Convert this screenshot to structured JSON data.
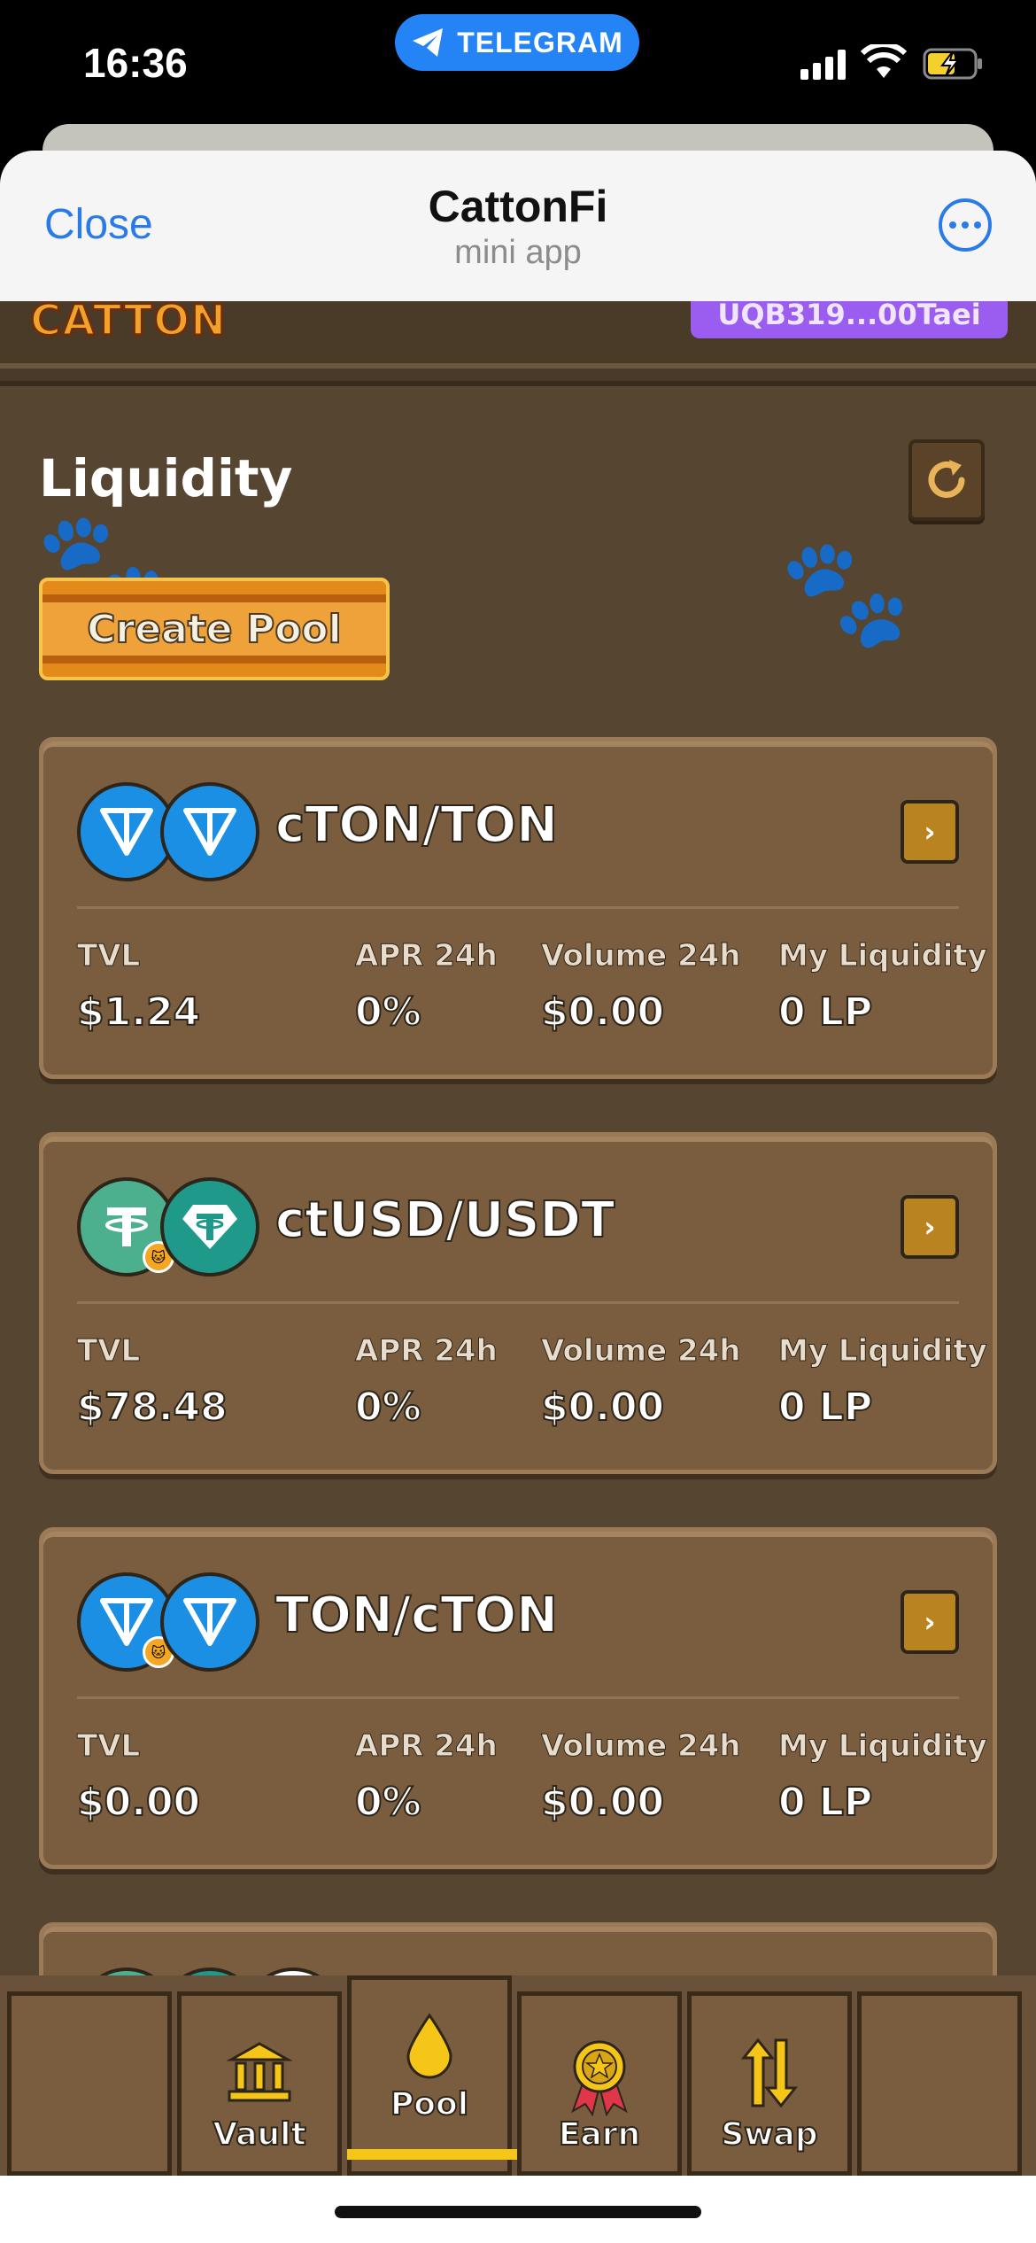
{
  "status_bar": {
    "time": "16:36",
    "center_pill": "TELEGRAM"
  },
  "telegram_header": {
    "close_label": "Close",
    "title": "CattonFi",
    "subtitle": "mini app"
  },
  "app": {
    "logo": "CATTON",
    "wallet": "UQB319...00Taei",
    "section_title": "Liquidity",
    "create_pool_label": "Create Pool",
    "stat_labels": {
      "tvl": "TVL",
      "apr": "APR 24h",
      "volume": "Volume 24h",
      "liquidity": "My Liquidity"
    },
    "pools": [
      {
        "pair": "cTON/TON",
        "tvl": "$1.24",
        "apr": "0%",
        "volume": "$0.00",
        "my_liquidity": "0 LP",
        "coin_a": "ton-icon",
        "coin_b": "ton-icon"
      },
      {
        "pair": "ctUSD/USDT",
        "tvl": "$78.48",
        "apr": "0%",
        "volume": "$0.00",
        "my_liquidity": "0 LP",
        "coin_a": "tether-icon",
        "coin_b": "tether-icon"
      },
      {
        "pair": "TON/cTON",
        "tvl": "$0.00",
        "apr": "0%",
        "volume": "$0.00",
        "my_liquidity": "0 LP",
        "coin_a": "ton-icon",
        "coin_b": "ton-icon"
      }
    ]
  },
  "bottom_nav": {
    "items": [
      {
        "label": "Vault",
        "icon": "bank-icon"
      },
      {
        "label": "Pool",
        "icon": "droplet-icon",
        "active": true
      },
      {
        "label": "Earn",
        "icon": "medal-icon"
      },
      {
        "label": "Swap",
        "icon": "swap-arrows-icon"
      }
    ]
  },
  "colors": {
    "accent_blue": "#2a7be8",
    "telegram_pill": "#2584f5",
    "wallet_purple": "#9b5cf0",
    "active_bar": "#f5c518",
    "ton_blue": "#1a8fe3",
    "tether_green": "#3aa886"
  }
}
